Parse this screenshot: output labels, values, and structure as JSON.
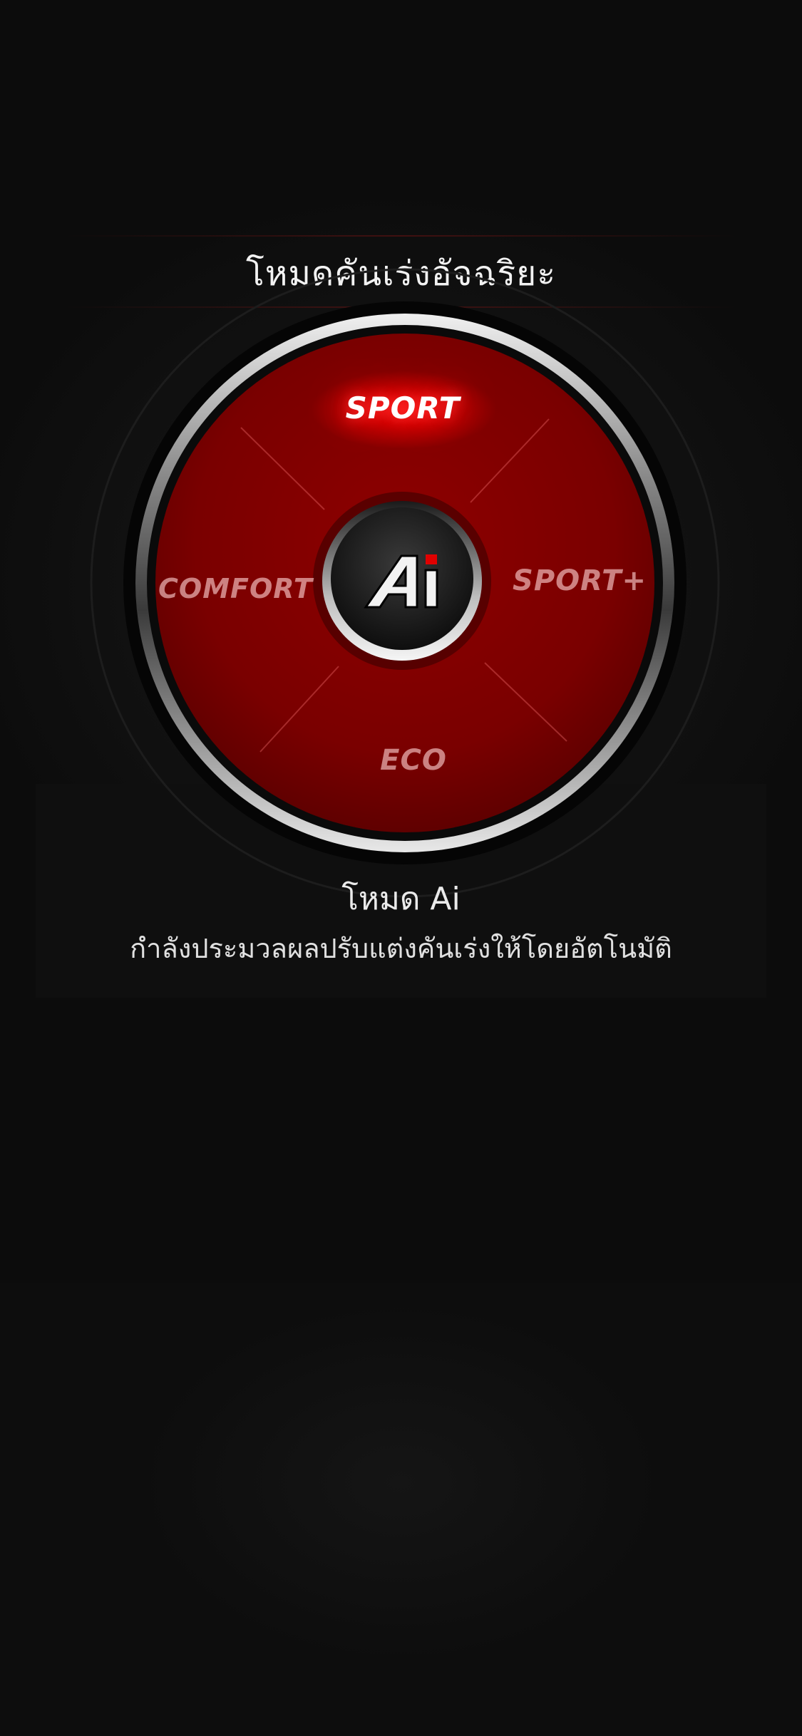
{
  "header": {
    "title": "โหมดคันเร่งอัจฉริยะ"
  },
  "dial": {
    "modes": [
      {
        "id": "sport",
        "label": "SPORT",
        "active": true
      },
      {
        "id": "sportplus",
        "label": "SPORT+",
        "active": false
      },
      {
        "id": "comfort",
        "label": "COMFORT",
        "active": false
      },
      {
        "id": "eco",
        "label": "ECO",
        "active": false
      }
    ],
    "center_logo": "Ai",
    "colors": {
      "dial_red": "#8a0000",
      "active_glow": "#ff2a2a",
      "logo_accent": "#e00000"
    }
  },
  "status": {
    "mode_name": "โหมด Ai",
    "description": "กำลังประมวลผลปรับแต่งคันเร่งให้โดยอัตโนมัติ"
  }
}
